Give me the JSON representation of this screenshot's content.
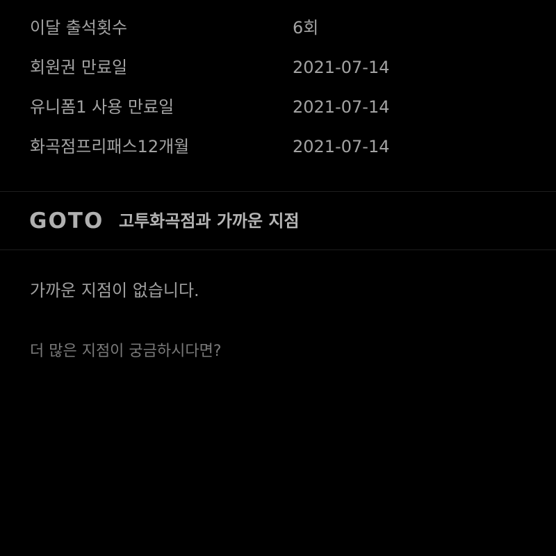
{
  "membership_info": {
    "rows": [
      {
        "label": "이달 출석횟수",
        "value": "6회"
      },
      {
        "label": "회원권 만료일",
        "value": "2021-07-14"
      },
      {
        "label": "유니폼1 사용 만료일",
        "value": "2021-07-14"
      },
      {
        "label": "화곡점프리패스12개월",
        "value": "2021-07-14"
      }
    ]
  },
  "nearby_branches": {
    "logo_text": "GOTO",
    "title": "고투화곡점과 가까운 지점",
    "empty_message": "가까운 지점이 없습니다.",
    "more_link": "더 많은 지점이 궁금하시다면?"
  }
}
